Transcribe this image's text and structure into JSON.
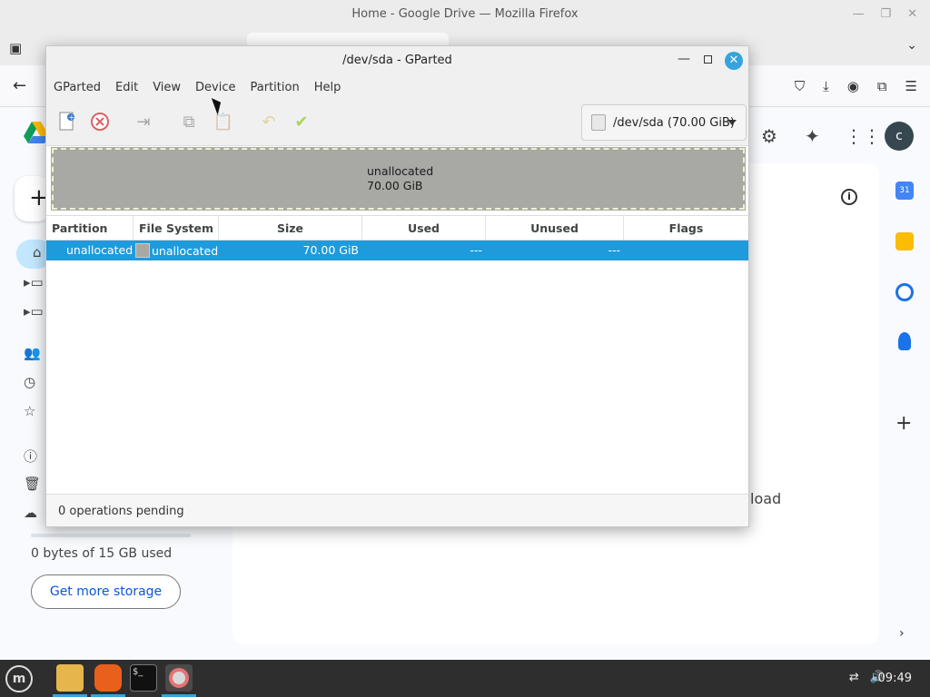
{
  "firefox": {
    "window_title": "Home - Google Drive — Mozilla Firefox"
  },
  "drive": {
    "storage_text": "0 bytes of 15 GB used",
    "get_more_storage": "Get more storage",
    "upload_fragment": "load",
    "avatar_letter": "c",
    "calendar_day": "31"
  },
  "gparted": {
    "title": "/dev/sda - GParted",
    "menu": [
      "GParted",
      "Edit",
      "View",
      "Device",
      "Partition",
      "Help"
    ],
    "device_selector": "/dev/sda (70.00 GiB)",
    "visual": {
      "label": "unallocated",
      "size": "70.00 GiB"
    },
    "columns": [
      "Partition",
      "File System",
      "Size",
      "Used",
      "Unused",
      "Flags"
    ],
    "rows": [
      {
        "partition": "unallocated",
        "filesystem": "unallocated",
        "size": "70.00 GiB",
        "used": "---",
        "unused": "---",
        "flags": ""
      }
    ],
    "status": "0 operations pending"
  },
  "taskbar": {
    "clock": "09:49"
  },
  "colors": {
    "selection": "#1e9bdc",
    "unallocated": "#a8a8a4",
    "close_button": "#35a4dc"
  }
}
